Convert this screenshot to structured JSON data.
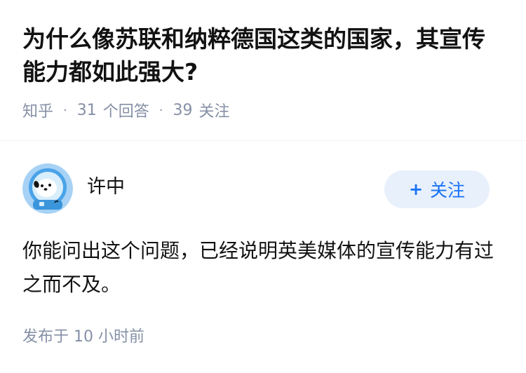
{
  "question": {
    "title": "为什么像苏联和纳粹德国这类的国家，其宣传能力都如此强大?",
    "source": "知乎",
    "answer_count": "31",
    "answer_label": "个回答",
    "follower_count": "39",
    "follower_label": "关注"
  },
  "answer": {
    "author_name": "许中",
    "follow_label": "关注",
    "content": "你能问出这个问题，已经说明英美媒体的宣传能力有过之而不及。",
    "posted_prefix": "发布于",
    "posted_time": "10 小时前"
  },
  "colors": {
    "accent": "#1772f6",
    "meta_text": "#8590a6",
    "follow_bg": "#e8f0fc"
  },
  "icons": {
    "avatar": "default-bear-astronaut-avatar",
    "follow": "plus-icon"
  }
}
